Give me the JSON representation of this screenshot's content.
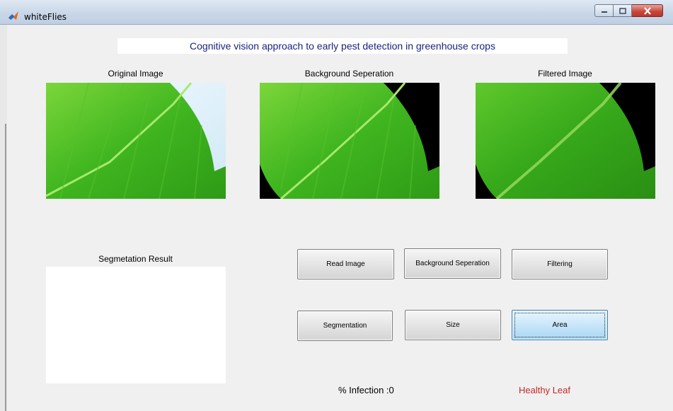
{
  "window": {
    "title": "whiteFlies",
    "icons": {
      "app": "matlab-icon",
      "minimize": "minimize-icon",
      "maximize": "maximize-icon",
      "close": "close-icon"
    }
  },
  "header": {
    "title": "Cognitive vision approach to early pest detection in greenhouse crops"
  },
  "panels": {
    "original_label": "Original Image",
    "background_label": "Background Seperation",
    "filtered_label": "Filtered Image",
    "segmentation_label": "Segmetation Result"
  },
  "buttons": {
    "read_image": "Read Image",
    "background_separation": "Background Seperation",
    "filtering": "Filtering",
    "segmentation": "Segmentation",
    "size": "Size",
    "area": "Area"
  },
  "results": {
    "infection_text": "% Infection :0",
    "verdict_text": "Healthy Leaf"
  },
  "colors": {
    "header_text": "#1a237e",
    "verdict": "#c62828",
    "leaf_green": "#3fb51f",
    "active_button": "#c8e6f9"
  }
}
